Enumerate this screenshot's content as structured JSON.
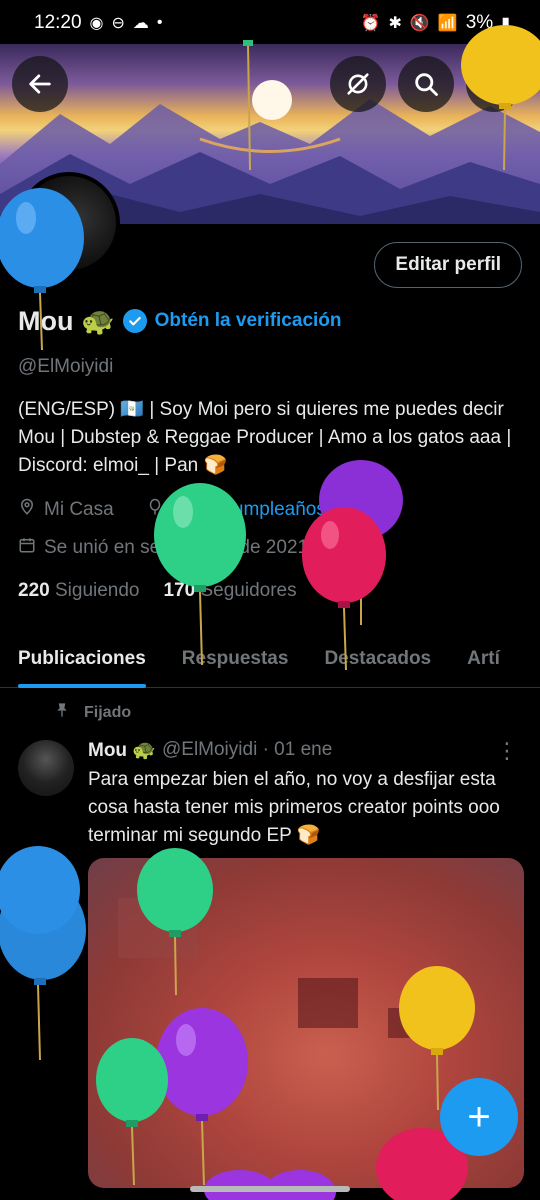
{
  "status_bar": {
    "time": "12:20",
    "battery": "3%"
  },
  "header": {
    "back_icon": "arrow-left-icon",
    "grok_icon": "grok-icon",
    "search_icon": "search-icon",
    "more_icon": "more-vertical-icon"
  },
  "profile": {
    "edit_label": "Editar perfil",
    "name": "Mou 🐢",
    "verify_label": "Obtén la verificación",
    "handle": "@ElMoiyidi",
    "bio": "(ENG/ESP) 🇬🇹 | Soy Moi pero si quieres me puedes decir Mou | Dubstep & Reggae Producer | Amo a los gatos aaa | Discord: elmoi_ | Pan 🍞",
    "location": "Mi Casa",
    "birthday_link": "¡Feliz cumpleaños!",
    "joined": "Se unió en septiembre de 2021",
    "following_count": "220",
    "following_label": "Siguiendo",
    "followers_count": "170",
    "followers_label": "Seguidores"
  },
  "tabs": [
    {
      "label": "Publicaciones"
    },
    {
      "label": "Respuestas"
    },
    {
      "label": "Destacados"
    },
    {
      "label": "Artí"
    }
  ],
  "pinned_label": "Fijado",
  "post": {
    "author": "Mou 🐢",
    "handle_date": "@ElMoiyidi · 01 ene",
    "text": "Para empezar bien el año, no voy a desfijar esta cosa hasta tener mis primeros creator points ooo terminar mi segundo EP 🍞"
  },
  "fab_label": "+",
  "colors": {
    "accent": "#1d9bf0",
    "text": "#e7e9ea",
    "muted": "#71767b",
    "background": "#000000"
  }
}
